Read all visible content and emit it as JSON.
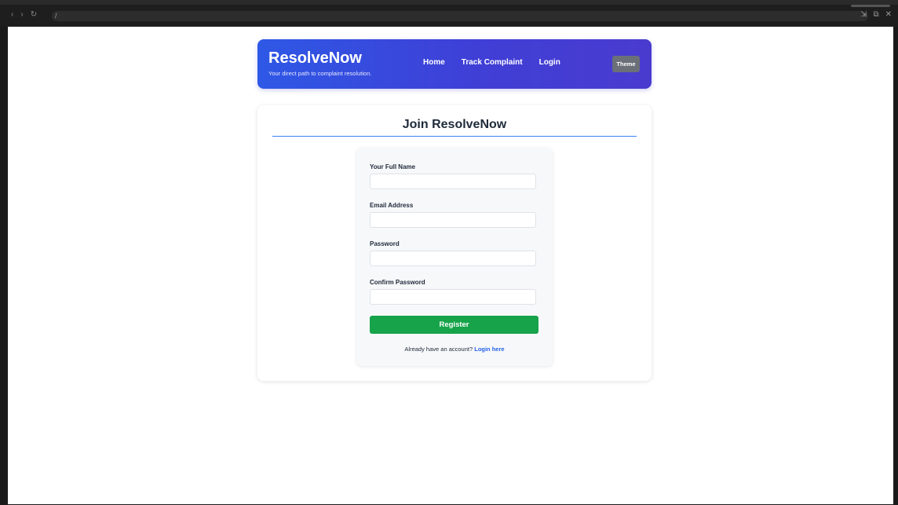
{
  "browser": {
    "back_icon": "‹",
    "forward_icon": "›",
    "reload_icon": "↻",
    "address": "/",
    "window_icons": [
      "⇲",
      "⧉",
      "✕"
    ]
  },
  "header": {
    "brand": "ResolveNow",
    "tagline": "Your direct path to complaint resolution.",
    "nav": [
      "Home",
      "Track Complaint",
      "Login"
    ],
    "theme_button": "Theme",
    "gradient_start": "#2e58e6",
    "gradient_end": "#4a3bcf"
  },
  "card": {
    "title": "Join ResolveNow"
  },
  "form": {
    "fields": [
      {
        "label": "Your Full Name",
        "value": ""
      },
      {
        "label": "Email Address",
        "value": ""
      },
      {
        "label": "Password",
        "value": ""
      },
      {
        "label": "Confirm Password",
        "value": ""
      }
    ],
    "submit": "Register",
    "login_prompt": "Already have an account?",
    "login_link": "Login here",
    "accent_color": "#16a34a",
    "link_color": "#2563eb"
  }
}
